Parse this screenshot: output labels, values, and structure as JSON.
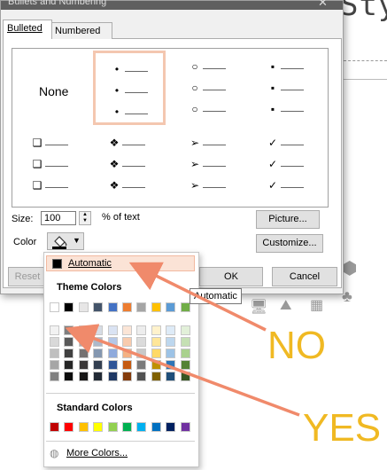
{
  "background": {
    "heading": "Sty"
  },
  "dialog": {
    "title": "Bullets and Numbering",
    "close_glyph": "✕",
    "tabs": [
      {
        "label": "Bulleted",
        "active": true
      },
      {
        "label": "Numbered",
        "active": false
      }
    ],
    "gallery": {
      "none_label": "None",
      "row1": [
        "•",
        "○",
        "▪"
      ],
      "row2": [
        "❑",
        "❖",
        "➢",
        "✓"
      ]
    },
    "size": {
      "label": "Size:",
      "value": "100",
      "unit": "% of text"
    },
    "color": {
      "label": "Color"
    },
    "buttons": {
      "picture": "Picture...",
      "customize": "Customize...",
      "reset": "Reset",
      "ok": "OK",
      "cancel": "Cancel"
    }
  },
  "color_menu": {
    "automatic": "Automatic",
    "theme_title": "Theme Colors",
    "theme_row": [
      "#ffffff",
      "#000000",
      "#e7e6e6",
      "#44546a",
      "#4472c4",
      "#ed7d31",
      "#a5a5a5",
      "#ffc000",
      "#5b9bd5",
      "#70ad47"
    ],
    "shade_cols": [
      [
        "#f2f2f2",
        "#d9d9d9",
        "#bfbfbf",
        "#a6a6a6",
        "#808080"
      ],
      [
        "#7f7f7f",
        "#595959",
        "#404040",
        "#262626",
        "#0d0d0d"
      ],
      [
        "#d0cece",
        "#aeaaaa",
        "#757171",
        "#3a3838",
        "#171616"
      ],
      [
        "#d6dce5",
        "#adb9ca",
        "#8497b0",
        "#333f50",
        "#222a35"
      ],
      [
        "#dae3f3",
        "#b4c7e7",
        "#8faadc",
        "#2f5597",
        "#1f3864"
      ],
      [
        "#fbe5d6",
        "#f8cbad",
        "#f4b183",
        "#c55a11",
        "#843c0c"
      ],
      [
        "#ededed",
        "#dbdbdb",
        "#c9c9c9",
        "#7b7b7b",
        "#525252"
      ],
      [
        "#fff2cc",
        "#ffe699",
        "#ffd966",
        "#bf9000",
        "#7f6000"
      ],
      [
        "#deebf7",
        "#bdd7ee",
        "#9dc3e6",
        "#2e75b6",
        "#1f4e79"
      ],
      [
        "#e2f0d9",
        "#c5e0b4",
        "#a9d18e",
        "#548235",
        "#385723"
      ]
    ],
    "standard_title": "Standard Colors",
    "standard_row": [
      "#c00000",
      "#ff0000",
      "#ffc000",
      "#ffff00",
      "#92d050",
      "#00b050",
      "#00b0f0",
      "#0070c0",
      "#002060",
      "#7030a0"
    ],
    "more_colors": "More Colors..."
  },
  "tooltip": "Automatic",
  "annotations": {
    "no": "NO",
    "yes": "YES",
    "arrow_color": "#f08a6b"
  }
}
